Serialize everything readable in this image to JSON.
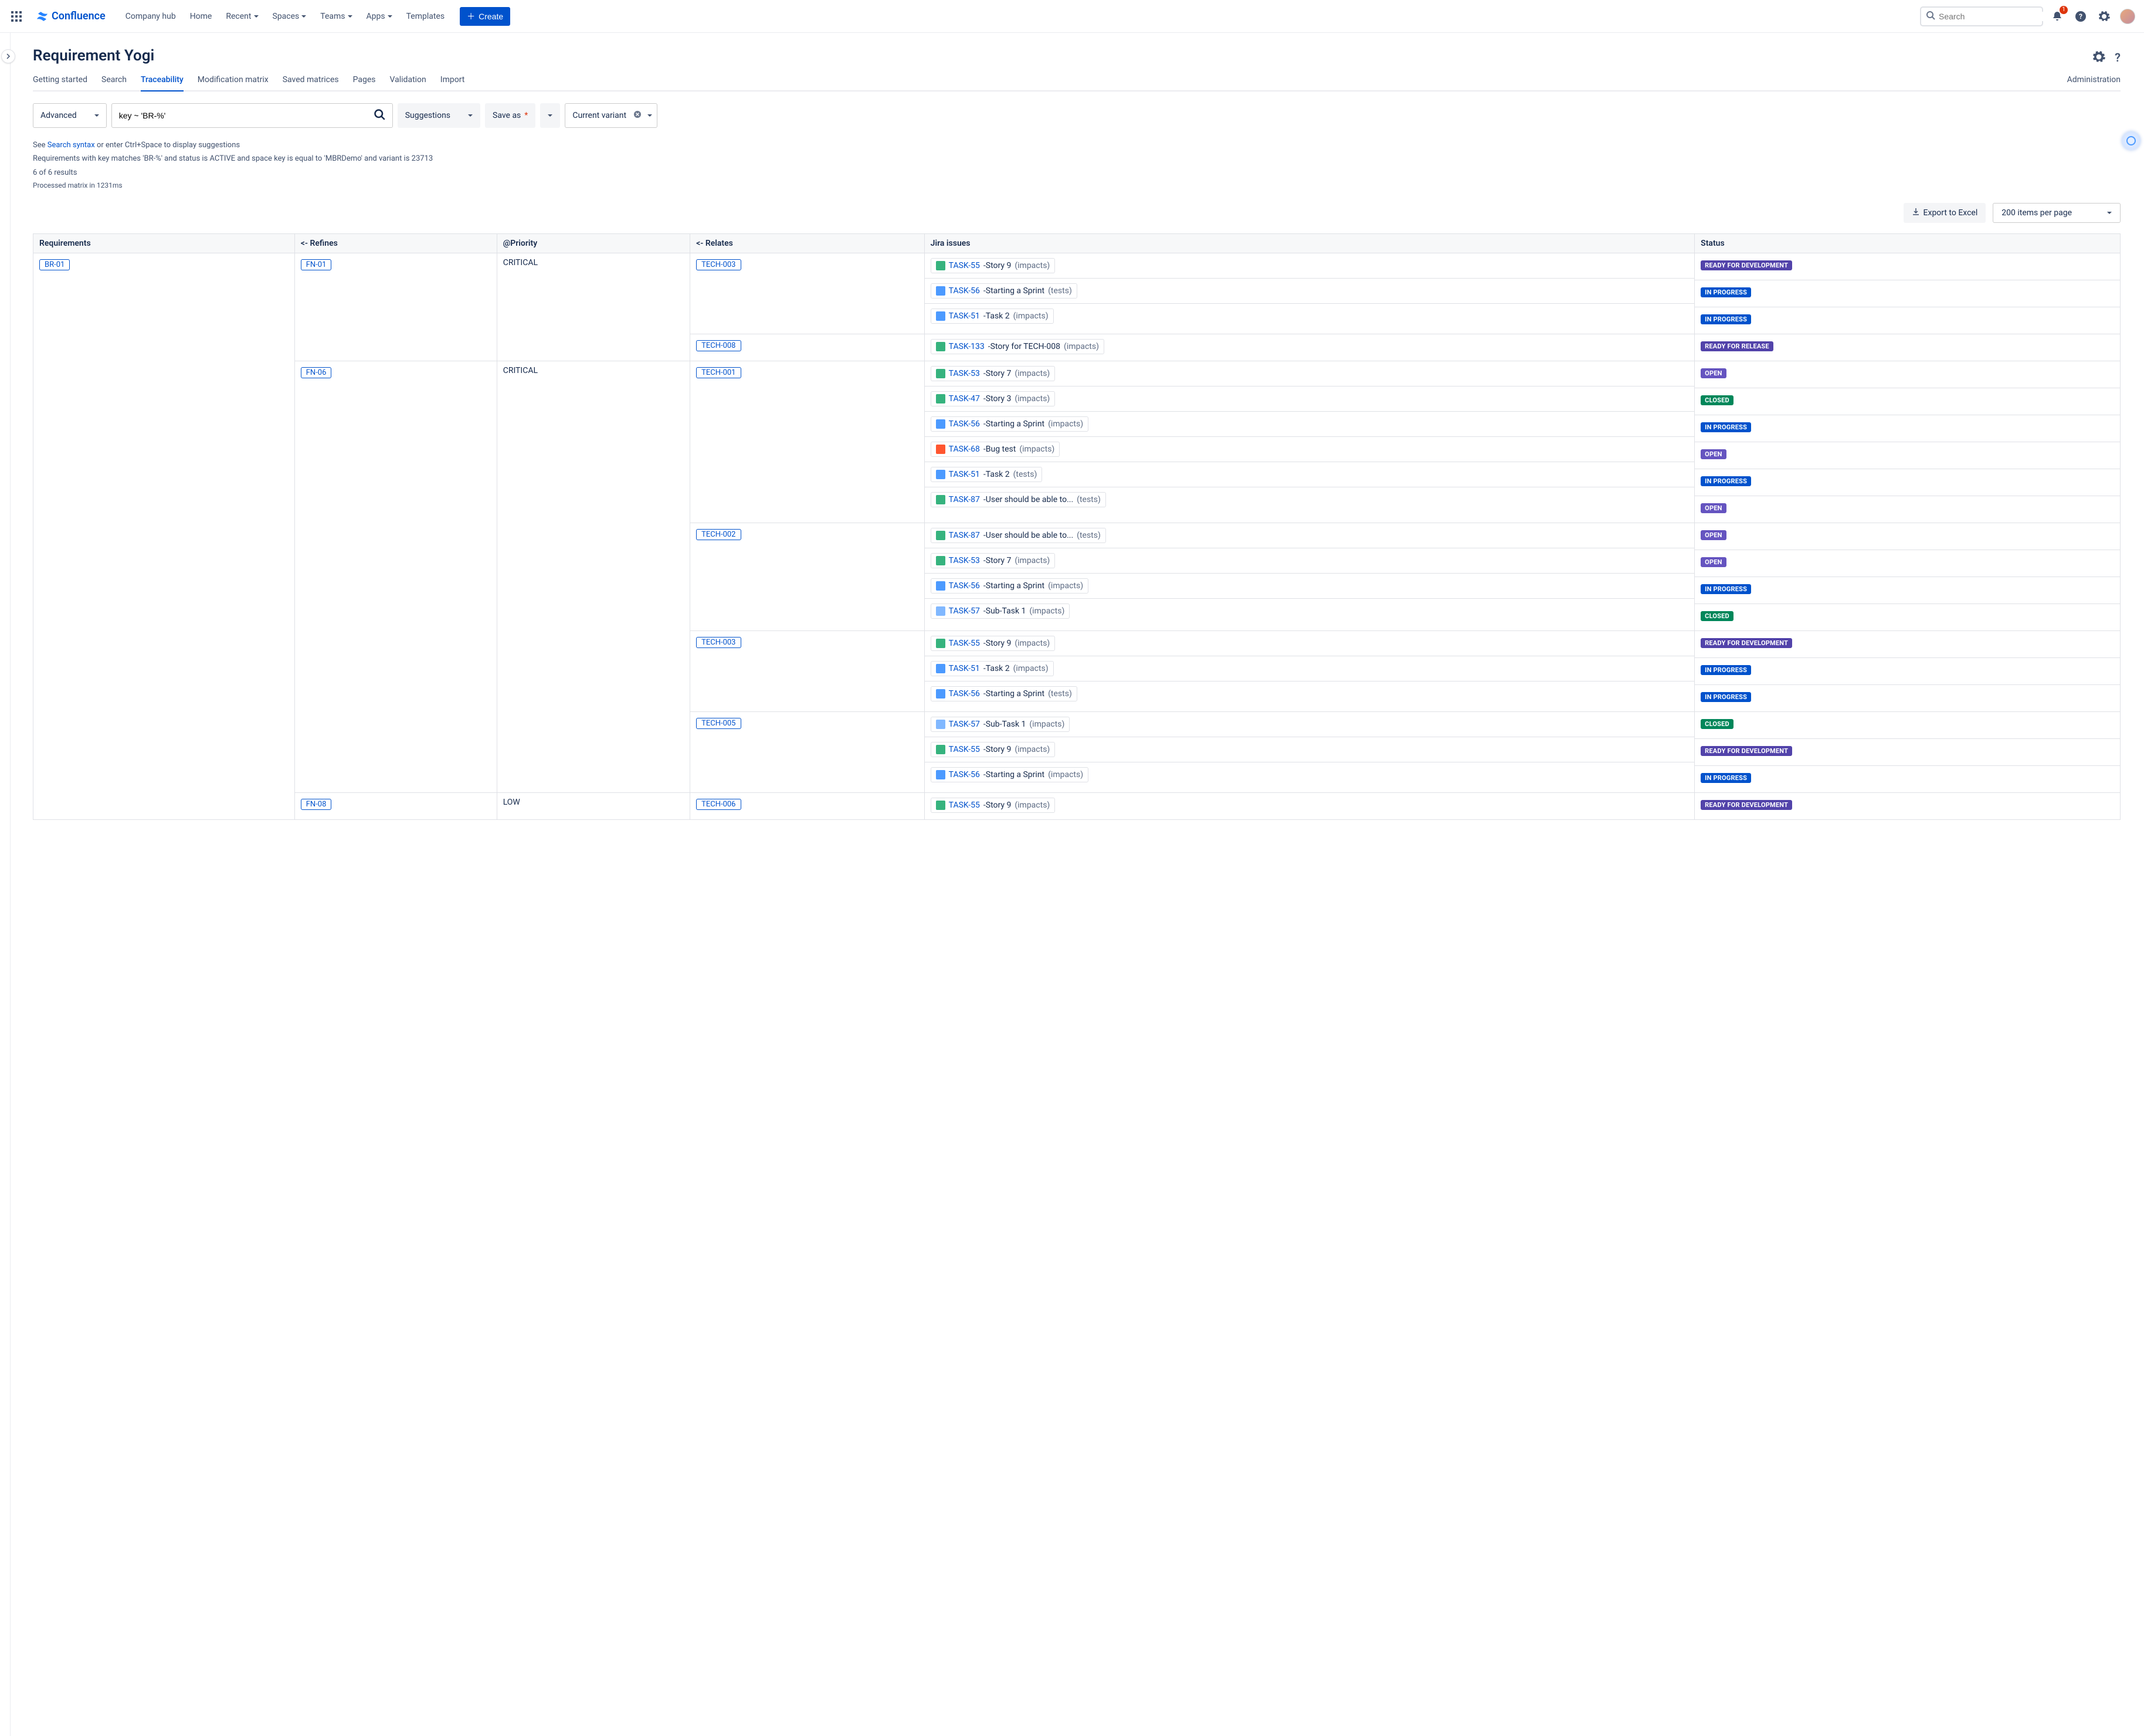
{
  "topnav": {
    "product": "Confluence",
    "links": [
      {
        "label": "Company hub",
        "chev": false
      },
      {
        "label": "Home",
        "chev": false
      },
      {
        "label": "Recent",
        "chev": true
      },
      {
        "label": "Spaces",
        "chev": true
      },
      {
        "label": "Teams",
        "chev": true
      },
      {
        "label": "Apps",
        "chev": true
      },
      {
        "label": "Templates",
        "chev": false
      }
    ],
    "create": "Create",
    "search_placeholder": "Search",
    "notif_count": "1"
  },
  "page": {
    "title": "Requirement Yogi",
    "tabs": [
      "Getting started",
      "Search",
      "Traceability",
      "Modification matrix",
      "Saved matrices",
      "Pages",
      "Validation",
      "Import"
    ],
    "active_tab": "Traceability",
    "admin_link": "Administration"
  },
  "controls": {
    "mode": "Advanced",
    "query": "key ~ 'BR-%'",
    "suggestions": "Suggestions",
    "save_as": "Save as",
    "variant": "Current variant"
  },
  "hints": {
    "prefix": "See ",
    "link": "Search syntax",
    "suffix": " or enter Ctrl+Space to display suggestions",
    "filter": "Requirements with key matches 'BR-%' and status is ACTIVE and space key is equal to 'MBRDemo' and variant is 23713",
    "count": "6 of 6 results",
    "timing": "Processed matrix in 1231ms"
  },
  "toolbar": {
    "export": "Export to Excel",
    "page_size": "200 items per page"
  },
  "columns": [
    "Requirements",
    "<- Refines",
    "@Priority",
    "<- Relates",
    "Jira issues",
    "Status"
  ],
  "status_map": {
    "READY FOR DEVELOPMENT": "st-ready-dev",
    "IN PROGRESS": "st-in-progress",
    "READY FOR RELEASE": "st-ready-rel",
    "OPEN": "st-open",
    "CLOSED": "st-closed"
  },
  "rows": [
    {
      "requirement": "BR-01",
      "refines": [
        {
          "key": "FN-01",
          "priority": "CRITICAL",
          "relates": [
            {
              "key": "TECH-003",
              "jira": [
                {
                  "icon": "story",
                  "key": "TASK-55",
                  "title": "Story 9",
                  "paren": "(impacts)",
                  "status": "READY FOR DEVELOPMENT"
                },
                {
                  "icon": "task",
                  "key": "TASK-56",
                  "title": "Starting a Sprint",
                  "paren": "(tests)",
                  "status": "IN PROGRESS"
                },
                {
                  "icon": "task",
                  "key": "TASK-51",
                  "title": "Task 2",
                  "paren": "(impacts)",
                  "status": "IN PROGRESS"
                }
              ]
            },
            {
              "key": "TECH-008",
              "jira": [
                {
                  "icon": "story",
                  "key": "TASK-133",
                  "title": "Story for TECH-008",
                  "paren": "(impacts)",
                  "status": "READY FOR RELEASE"
                }
              ]
            }
          ]
        },
        {
          "key": "FN-06",
          "priority": "CRITICAL",
          "relates": [
            {
              "key": "TECH-001",
              "jira": [
                {
                  "icon": "story",
                  "key": "TASK-53",
                  "title": "Story 7",
                  "paren": "(impacts)",
                  "status": "OPEN"
                },
                {
                  "icon": "story",
                  "key": "TASK-47",
                  "title": "Story 3",
                  "paren": "(impacts)",
                  "status": "CLOSED"
                },
                {
                  "icon": "task",
                  "key": "TASK-56",
                  "title": "Starting a Sprint",
                  "paren": "(impacts)",
                  "status": "IN PROGRESS"
                },
                {
                  "icon": "bug",
                  "key": "TASK-68",
                  "title": "Bug test",
                  "paren": "(impacts)",
                  "status": "OPEN"
                },
                {
                  "icon": "task",
                  "key": "TASK-51",
                  "title": "Task 2",
                  "paren": "(tests)",
                  "status": "IN PROGRESS"
                },
                {
                  "icon": "plus",
                  "key": "TASK-87",
                  "title": "User should be able to...",
                  "paren": "(tests)",
                  "status": "OPEN"
                }
              ]
            },
            {
              "key": "TECH-002",
              "jira": [
                {
                  "icon": "plus",
                  "key": "TASK-87",
                  "title": "User should be able to...",
                  "paren": "(tests)",
                  "status": "OPEN"
                },
                {
                  "icon": "story",
                  "key": "TASK-53",
                  "title": "Story 7",
                  "paren": "(impacts)",
                  "status": "OPEN"
                },
                {
                  "icon": "task",
                  "key": "TASK-56",
                  "title": "Starting a Sprint",
                  "paren": "(impacts)",
                  "status": "IN PROGRESS"
                },
                {
                  "icon": "subtask",
                  "key": "TASK-57",
                  "title": "Sub-Task 1",
                  "paren": "(impacts)",
                  "status": "CLOSED"
                }
              ]
            },
            {
              "key": "TECH-003",
              "jira": [
                {
                  "icon": "story",
                  "key": "TASK-55",
                  "title": "Story 9",
                  "paren": "(impacts)",
                  "status": "READY FOR DEVELOPMENT"
                },
                {
                  "icon": "task",
                  "key": "TASK-51",
                  "title": "Task 2",
                  "paren": "(impacts)",
                  "status": "IN PROGRESS"
                },
                {
                  "icon": "task",
                  "key": "TASK-56",
                  "title": "Starting a Sprint",
                  "paren": "(tests)",
                  "status": "IN PROGRESS"
                }
              ]
            },
            {
              "key": "TECH-005",
              "jira": [
                {
                  "icon": "subtask",
                  "key": "TASK-57",
                  "title": "Sub-Task 1",
                  "paren": "(impacts)",
                  "status": "CLOSED"
                },
                {
                  "icon": "story",
                  "key": "TASK-55",
                  "title": "Story 9",
                  "paren": "(impacts)",
                  "status": "READY FOR DEVELOPMENT"
                },
                {
                  "icon": "task",
                  "key": "TASK-56",
                  "title": "Starting a Sprint",
                  "paren": "(impacts)",
                  "status": "IN PROGRESS"
                }
              ]
            }
          ]
        },
        {
          "key": "FN-08",
          "priority": "LOW",
          "relates": [
            {
              "key": "TECH-006",
              "jira": [
                {
                  "icon": "story",
                  "key": "TASK-55",
                  "title": "Story 9",
                  "paren": "(impacts)",
                  "status": "READY FOR DEVELOPMENT"
                }
              ]
            }
          ]
        }
      ]
    }
  ]
}
